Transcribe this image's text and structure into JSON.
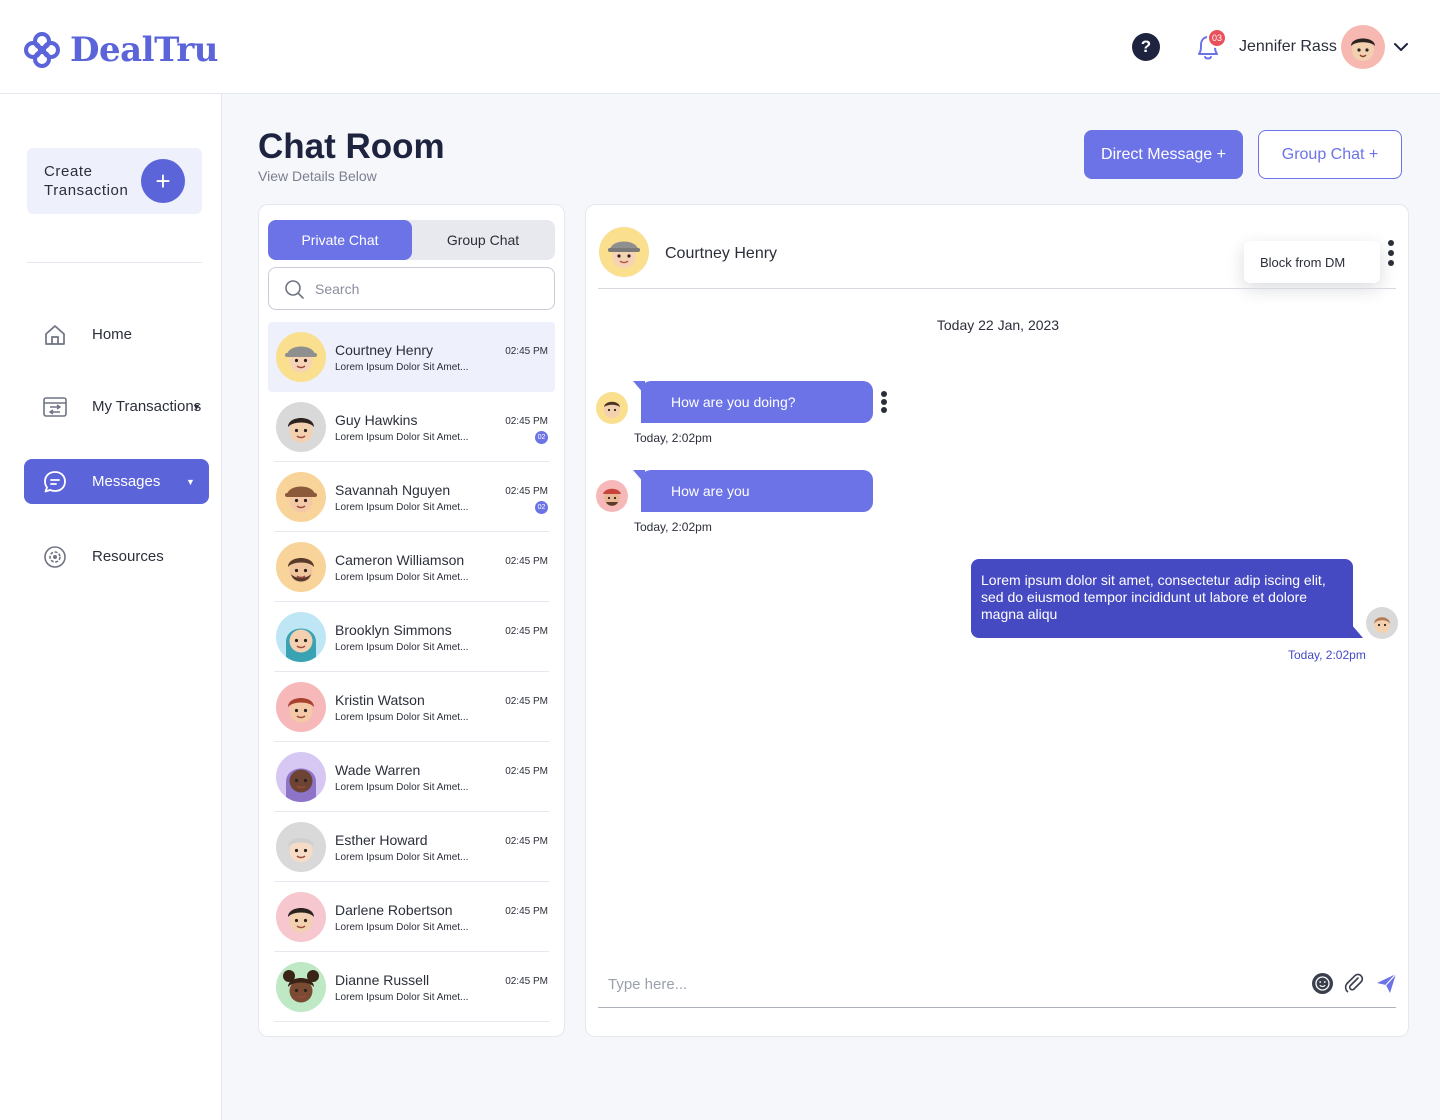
{
  "app": {
    "logo_text": "DealTru",
    "brand_color": "#5b64d9"
  },
  "header": {
    "help_label": "?",
    "notification_count": "03",
    "user_name": "Jennifer Rass"
  },
  "sidebar": {
    "create_label": "Create Transaction",
    "create_icon": "plus-icon",
    "items": [
      {
        "label": "Home",
        "icon": "home-icon",
        "active": false
      },
      {
        "label": "My Transactions",
        "icon": "transactions-icon",
        "active": false,
        "has_caret": true
      },
      {
        "label": "Messages",
        "icon": "chat-icon",
        "active": true,
        "has_caret": true
      },
      {
        "label": "Resources",
        "icon": "gear-icon",
        "active": false
      }
    ]
  },
  "page": {
    "title": "Chat Room",
    "subtitle": "View Details Below",
    "dm_button": "Direct Message +",
    "group_button": "Group Chat +"
  },
  "chat_list": {
    "tabs": [
      "Private Chat",
      "Group Chat"
    ],
    "active_tab": 0,
    "search_placeholder": "Search",
    "contacts": [
      {
        "name": "Courtney Henry",
        "preview": "Lorem Ipsum Dolor Sit Amet...",
        "time": "02:45 PM",
        "badge": "",
        "active": true,
        "avatar_bg": "#f9df8e"
      },
      {
        "name": "Guy Hawkins",
        "preview": "Lorem Ipsum Dolor Sit Amet...",
        "time": "02:45 PM",
        "badge": "02",
        "active": false,
        "avatar_bg": "#d9d9d9"
      },
      {
        "name": "Savannah Nguyen",
        "preview": "Lorem Ipsum Dolor Sit Amet...",
        "time": "02:45 PM",
        "badge": "02",
        "active": false,
        "avatar_bg": "#f9d49a"
      },
      {
        "name": "Cameron Williamson",
        "preview": "Lorem Ipsum Dolor Sit Amet...",
        "time": "02:45 PM",
        "badge": "",
        "active": false,
        "avatar_bg": "#f9d49a"
      },
      {
        "name": "Brooklyn Simmons",
        "preview": "Lorem Ipsum Dolor Sit Amet...",
        "time": "02:45 PM",
        "badge": "",
        "active": false,
        "avatar_bg": "#bfe6f5"
      },
      {
        "name": "Kristin Watson",
        "preview": "Lorem Ipsum Dolor Sit Amet...",
        "time": "02:45 PM",
        "badge": "",
        "active": false,
        "avatar_bg": "#f6b8b8"
      },
      {
        "name": "Wade Warren",
        "preview": "Lorem Ipsum Dolor Sit Amet...",
        "time": "02:45 PM",
        "badge": "",
        "active": false,
        "avatar_bg": "#d6c8f3"
      },
      {
        "name": "Esther Howard",
        "preview": "Lorem Ipsum Dolor Sit Amet...",
        "time": "02:45 PM",
        "badge": "",
        "active": false,
        "avatar_bg": "#d9d9d9"
      },
      {
        "name": "Darlene Robertson",
        "preview": "Lorem Ipsum Dolor Sit Amet...",
        "time": "02:45 PM",
        "badge": "",
        "active": false,
        "avatar_bg": "#f6c7cf"
      },
      {
        "name": "Dianne Russell",
        "preview": "Lorem Ipsum Dolor Sit Amet...",
        "time": "02:45 PM",
        "badge": "",
        "active": false,
        "avatar_bg": "#bfe8c4"
      }
    ]
  },
  "chat": {
    "contact_name": "Courtney Henry",
    "menu_item": "Block from DM",
    "date_label": "Today 22 Jan, 2023",
    "messages": [
      {
        "text": "How are you doing?",
        "time": "Today, 2:02pm",
        "direction": "in"
      },
      {
        "text": "How are you",
        "time": "Today, 2:02pm",
        "direction": "in"
      },
      {
        "text": "Lorem ipsum dolor sit amet, consectetur adip iscing elit, sed do eiusmod tempor incididunt ut labore et dolore magna aliqu",
        "time": "Today, 2:02pm",
        "direction": "out"
      }
    ],
    "composer_placeholder": "Type here...",
    "composer_icons": [
      "emoji-icon",
      "paperclip-icon",
      "send-icon"
    ]
  }
}
